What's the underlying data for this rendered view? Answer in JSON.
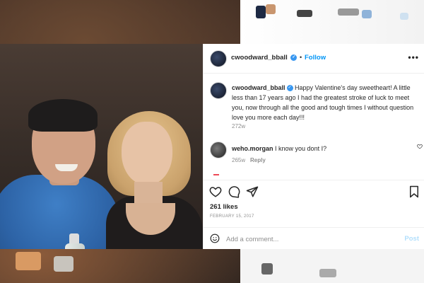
{
  "post": {
    "header": {
      "username": "cwoodward_bball",
      "separator": "•",
      "follow_label": "Follow",
      "more_label": "•••"
    },
    "caption": {
      "username": "cwoodward_bball",
      "text": "Happy Valentine's day sweetheart! A little less than 17 years ago I had the greatest stroke of luck to meet you, now through all the good and tough times I without question love you more each day!!!",
      "age": "272w"
    },
    "comments": [
      {
        "username": "weho.morgan",
        "text": "I know you dont I?",
        "age": "265w",
        "reply_label": "Reply"
      }
    ],
    "likes": "261 likes",
    "date": "FEBRUARY 15, 2017",
    "add_comment": {
      "placeholder": "Add a comment...",
      "post_label": "Post"
    }
  },
  "icons": {
    "header_avatar": "avatar-icon",
    "verified": "verified-badge-icon",
    "like": "heart-icon",
    "comment": "comment-bubble-icon",
    "share": "paper-plane-icon",
    "save": "bookmark-icon",
    "emoji": "smiley-face-icon"
  },
  "colors": {
    "accent": "#0095f6",
    "verified": "#3897f0",
    "muted": "#8e8e8e",
    "text": "#262626"
  }
}
